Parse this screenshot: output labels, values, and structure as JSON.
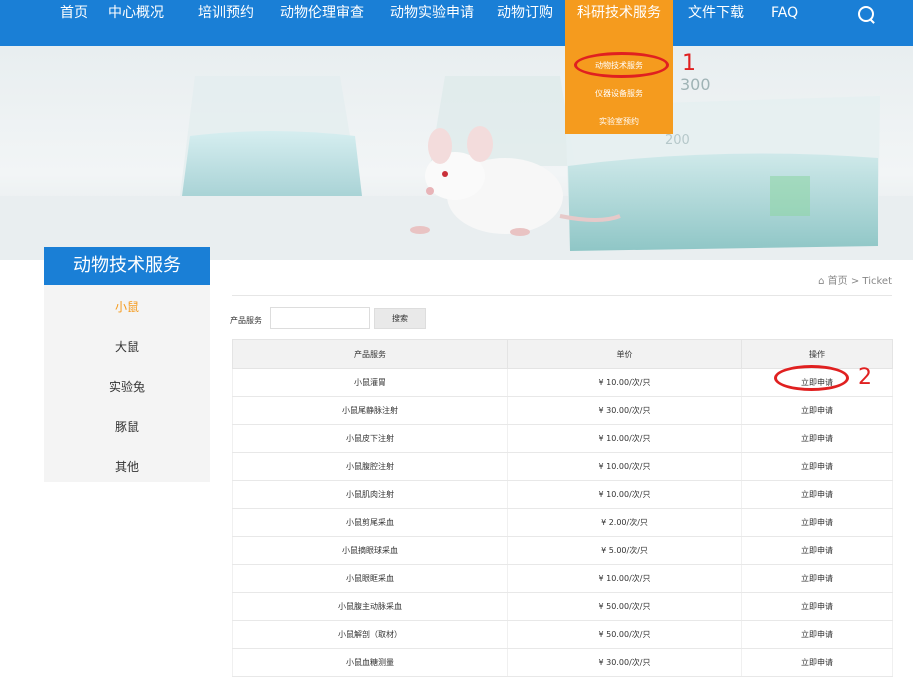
{
  "nav": {
    "items": [
      "首页",
      "中心概况",
      "培训预约",
      "动物伦理审查",
      "动物实验申请",
      "动物订购",
      "科研技术服务",
      "文件下载",
      "FAQ"
    ],
    "active_index": 6
  },
  "dropdown": {
    "items": [
      "动物技术服务",
      "仪器设备服务",
      "实验室预约"
    ]
  },
  "annotations": {
    "first": "1",
    "second": "2"
  },
  "banner": {
    "beaker_marks": [
      "300",
      "200"
    ]
  },
  "sidebar": {
    "title": "动物技术服务",
    "items": [
      "小鼠",
      "大鼠",
      "实验兔",
      "豚鼠",
      "其他"
    ],
    "active_index": 0
  },
  "breadcrumb": {
    "home": "首页",
    "current": "> Ticket"
  },
  "filter": {
    "label": "产品服务",
    "input_value": "",
    "button": "搜索"
  },
  "table": {
    "headers": [
      "产品服务",
      "单价",
      "操作"
    ],
    "rows": [
      {
        "service": "小鼠灌胃",
        "price": "¥ 10.00/次/只",
        "action": "立即申请"
      },
      {
        "service": "小鼠尾静脉注射",
        "price": "¥ 30.00/次/只",
        "action": "立即申请"
      },
      {
        "service": "小鼠皮下注射",
        "price": "¥ 10.00/次/只",
        "action": "立即申请"
      },
      {
        "service": "小鼠腹腔注射",
        "price": "¥ 10.00/次/只",
        "action": "立即申请"
      },
      {
        "service": "小鼠肌肉注射",
        "price": "¥ 10.00/次/只",
        "action": "立即申请"
      },
      {
        "service": "小鼠剪尾采血",
        "price": "¥ 2.00/次/只",
        "action": "立即申请"
      },
      {
        "service": "小鼠摘眼球采血",
        "price": "¥ 5.00/次/只",
        "action": "立即申请"
      },
      {
        "service": "小鼠眼眶采血",
        "price": "¥ 10.00/次/只",
        "action": "立即申请"
      },
      {
        "service": "小鼠腹主动脉采血",
        "price": "¥ 50.00/次/只",
        "action": "立即申请"
      },
      {
        "service": "小鼠解剖（取材）",
        "price": "¥ 50.00/次/只",
        "action": "立即申请"
      },
      {
        "service": "小鼠血糖测量",
        "price": "¥ 30.00/次/只",
        "action": "立即申请"
      }
    ]
  },
  "colors": {
    "primary": "#1a7fd6",
    "accent": "#f59b1e",
    "annotation": "#e02020"
  }
}
